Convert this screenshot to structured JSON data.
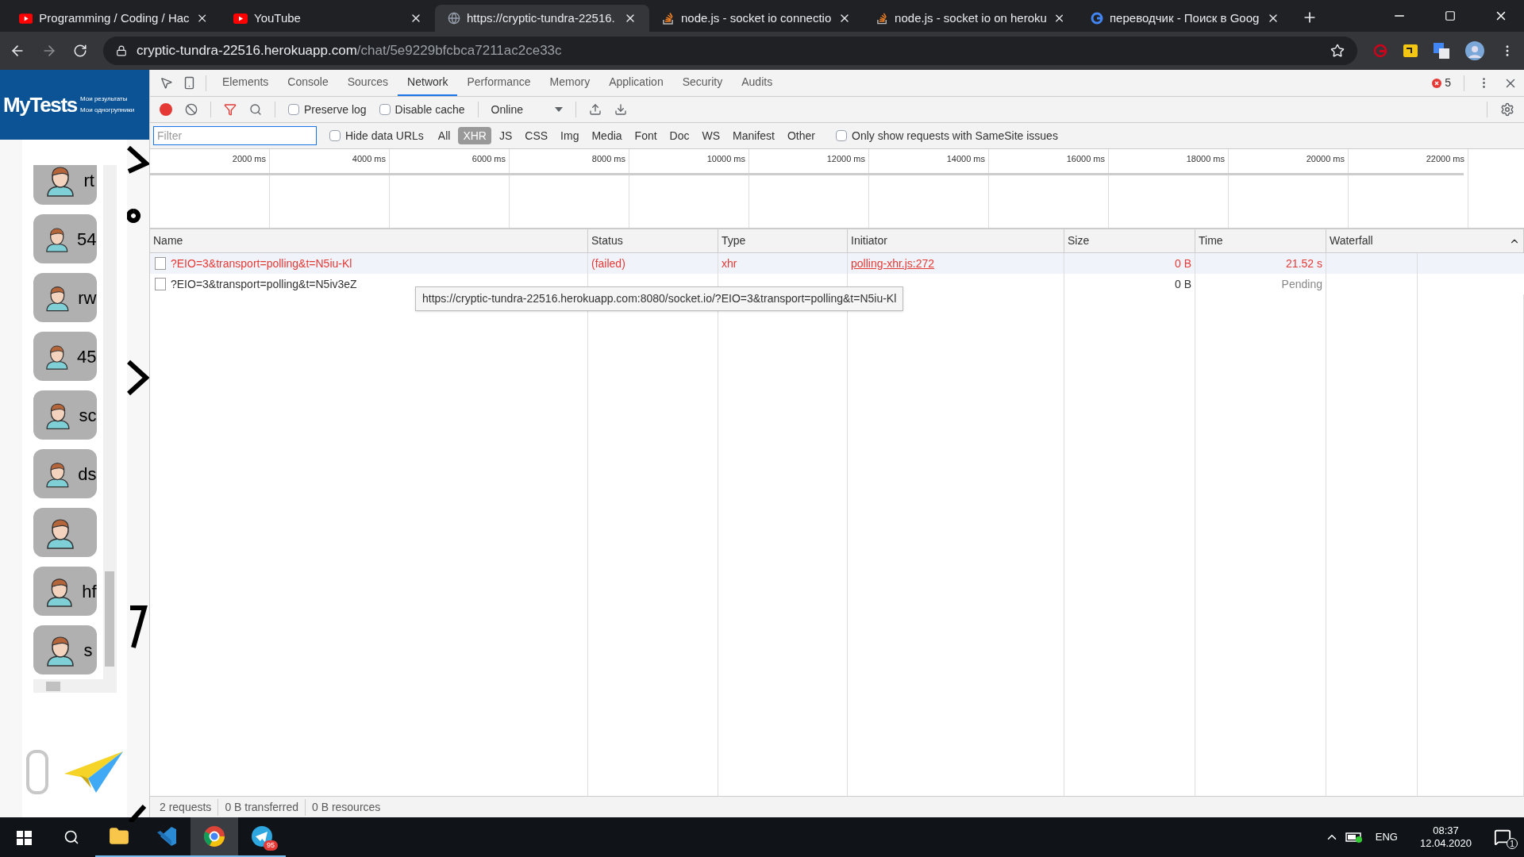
{
  "browser": {
    "tabs": [
      {
        "title": "Programming / Coding / Hac",
        "kind": "video",
        "selected": false
      },
      {
        "title": "YouTube",
        "kind": "video",
        "selected": false
      },
      {
        "title": "https://cryptic-tundra-22516.",
        "kind": "web",
        "selected": true
      },
      {
        "title": "node.js - socket io connectio",
        "kind": "qa",
        "selected": false
      },
      {
        "title": "node.js - socket io on heroku",
        "kind": "qa",
        "selected": false
      },
      {
        "title": "переводчик - Поиск в Goog",
        "kind": "search",
        "selected": false
      }
    ],
    "url_host": "cryptic-tundra-22516.herokuapp.com",
    "url_path": "/chat/5e9229bfcbca7211ac2ce33c"
  },
  "page": {
    "logo": "MyTests",
    "links": [
      "Мои результаты",
      "Мои одногрупники"
    ],
    "contacts": [
      {
        "kind": "named",
        "name": "rt"
      },
      {
        "kind": "named",
        "name": "54"
      },
      {
        "kind": "named",
        "name": "rw"
      },
      {
        "kind": "named",
        "name": "45"
      },
      {
        "kind": "named",
        "name": "sc"
      },
      {
        "kind": "named",
        "name": "ds"
      },
      {
        "kind": "unnamed"
      },
      {
        "kind": "named",
        "name": "hf"
      },
      {
        "kind": "named",
        "name": "s"
      }
    ]
  },
  "devtools": {
    "tabs": [
      {
        "label": "Elements",
        "selected": false
      },
      {
        "label": "Console",
        "selected": false
      },
      {
        "label": "Sources",
        "selected": false
      },
      {
        "label": "Network",
        "selected": true
      },
      {
        "label": "Performance",
        "selected": false
      },
      {
        "label": "Memory",
        "selected": false
      },
      {
        "label": "Application",
        "selected": false
      },
      {
        "label": "Security",
        "selected": false
      },
      {
        "label": "Audits",
        "selected": false
      }
    ],
    "error_count": "5",
    "toolbar": {
      "recording": true,
      "preserve_log": {
        "label": "Preserve log",
        "checked": false
      },
      "disable_cache": {
        "label": "Disable cache",
        "checked": false
      },
      "throttling": "Online"
    },
    "filter": {
      "placeholder": "Filter",
      "hide_data_urls": {
        "label": "Hide data URLs",
        "checked": false
      },
      "types": [
        {
          "label": "All",
          "selected": false
        },
        {
          "label": "XHR",
          "selected": true
        },
        {
          "label": "JS",
          "selected": false
        },
        {
          "label": "CSS",
          "selected": false
        },
        {
          "label": "Img",
          "selected": false
        },
        {
          "label": "Media",
          "selected": false
        },
        {
          "label": "Font",
          "selected": false
        },
        {
          "label": "Doc",
          "selected": false
        },
        {
          "label": "WS",
          "selected": false
        },
        {
          "label": "Manifest",
          "selected": false
        },
        {
          "label": "Other",
          "selected": false
        }
      ],
      "samesite": {
        "label": "Only show requests with SameSite issues",
        "checked": false
      }
    },
    "overview_ticks": [
      "2000 ms",
      "4000 ms",
      "6000 ms",
      "8000 ms",
      "10000 ms",
      "12000 ms",
      "14000 ms",
      "16000 ms",
      "18000 ms",
      "20000 ms",
      "22000 ms"
    ],
    "table": {
      "columns": [
        "Name",
        "Status",
        "Type",
        "Initiator",
        "Size",
        "Time",
        "Waterfall"
      ],
      "rows": [
        {
          "name": "?EIO=3&transport=polling&t=N5iu-Kl",
          "status": "(failed)",
          "type": "xhr",
          "initiator": "polling-xhr.js:272",
          "size": "0 B",
          "time": "21.52 s",
          "failed": true
        },
        {
          "name": "?EIO=3&transport=polling&t=N5iv3eZ",
          "size": "0 B",
          "time": "Pending",
          "failed": false
        }
      ]
    },
    "tooltip": "https://cryptic-tundra-22516.herokuapp.com:8080/socket.io/?EIO=3&transport=polling&t=N5iu-Kl",
    "status_bar": [
      "2 requests",
      "0 B transferred",
      "0 B resources"
    ]
  },
  "taskbar": {
    "telegram_badge": "95",
    "language": "ENG",
    "time": "08:37",
    "date": "12.04.2020",
    "notifications": "1"
  }
}
